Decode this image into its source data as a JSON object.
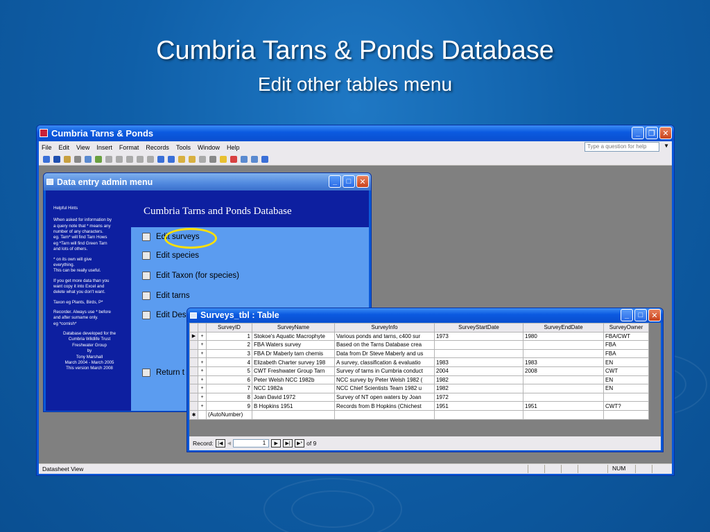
{
  "slide": {
    "title": "Cumbria Tarns & Ponds Database",
    "subtitle": "Edit other tables menu"
  },
  "app": {
    "title": "Cumbria Tarns & Ponds",
    "menu": [
      "File",
      "Edit",
      "View",
      "Insert",
      "Format",
      "Records",
      "Tools",
      "Window",
      "Help"
    ],
    "help_placeholder": "Type a question for help",
    "status_left": "Datasheet View",
    "status_right": "NUM"
  },
  "admin_menu": {
    "title": "Data entry admin menu",
    "header": "Cumbria Tarns and Ponds Database",
    "hints_title": "Helpful Hints",
    "hints": [
      "When asked for information by\na query note that * means any\nnumber of any characters.\neg. Tarn* will find Tarn Hows\neg *Tarn will find Green Tarn\nand lots of others.",
      "* on its own will give\neverything.\nThis can be really useful.",
      "If you get more data than you\nwant copy it into Excel and\ndelete what you don't want.",
      "Taxon eg Plants, Birds, P*",
      "Recorder. Always use * before\nand after surname only.\neg *cornish*"
    ],
    "credit": "Database developed for the\nCumbria Wildlife Trust\nFreshwater Group\nby\nTony Marshall\nMarch 2004 - March 2005\nThis version March 2008",
    "options": [
      "Edit surveys",
      "Edit species",
      "Edit Taxon (for species)",
      "Edit tarns",
      "Edit Des",
      "Return t"
    ]
  },
  "surveys_table": {
    "title": "Surveys_tbl : Table",
    "columns": [
      "SurveyID",
      "SurveyName",
      "SurveyInfo",
      "SurveyStartDate",
      "SurveyEndDate",
      "SurveyOwner"
    ],
    "rows": [
      [
        "1",
        "Stokoe's Aquatic Macrophyte",
        "Various ponds and tarns, c400 sur",
        "1973",
        "1980",
        "FBA/CWT"
      ],
      [
        "2",
        "FBA Waters survey",
        "Based on the Tarns Database crea",
        "",
        "",
        "FBA"
      ],
      [
        "3",
        "FBA Dr Maberly tarn chemis",
        "Data from Dr Steve Maberly and us",
        "",
        "",
        "FBA"
      ],
      [
        "4",
        "Elizabeth Charter survey 198",
        "A survey, classification & evaluatio",
        "1983",
        "1983",
        "EN"
      ],
      [
        "5",
        "CWT Freshwater Group Tarn",
        "Survey of tarns in Cumbria conduct",
        "2004",
        "2008",
        "CWT"
      ],
      [
        "6",
        "Peter Welsh NCC 1982b",
        "NCC survey by Peter Welsh 1982 (",
        "1982",
        "",
        "EN"
      ],
      [
        "7",
        "NCC 1982a",
        "NCC Chief Scientists Team 1982 u",
        "1982",
        "",
        "EN"
      ],
      [
        "8",
        "Joan David 1972",
        "Survey of NT open waters by Joan",
        "1972",
        "",
        ""
      ],
      [
        "9",
        "B Hopkins 1951",
        "Records from B Hopkins (Chichest",
        "1951",
        "1951",
        "CWT?"
      ]
    ],
    "new_row_label": "(AutoNumber)",
    "record_label": "Record:",
    "record_current": "1",
    "record_total": "of  9"
  }
}
